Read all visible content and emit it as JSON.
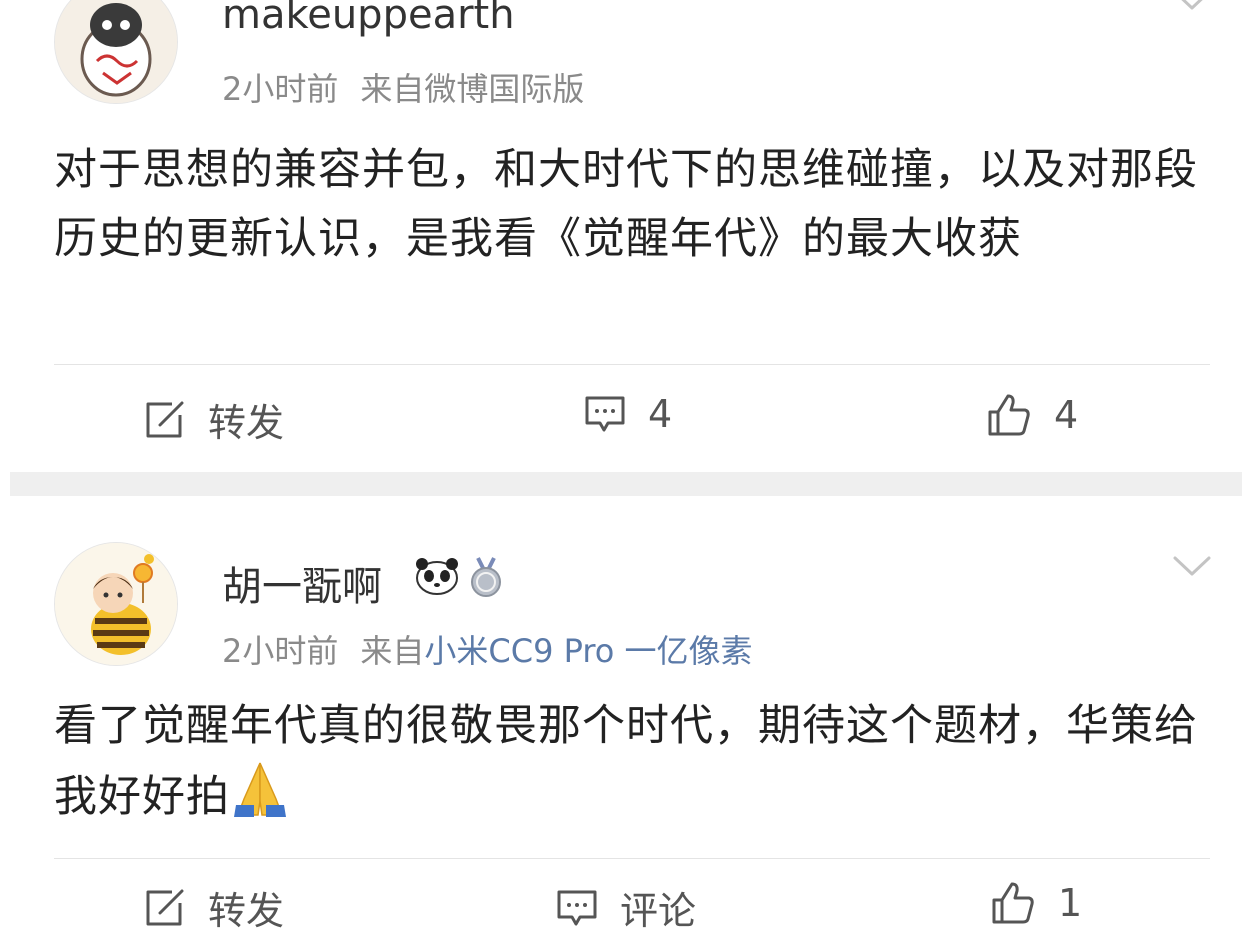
{
  "posts": [
    {
      "username": "makeuppearth",
      "time": "2小时前",
      "source_prefix": "来自",
      "source_name": "微博国际版",
      "content": "对于思想的兼容并包，和大时代下的思维碰撞，以及对那段历史的更新认识，是我看《觉醒年代》的最大收获",
      "actions": {
        "repost": "转发",
        "comment": "4",
        "like": "4"
      }
    },
    {
      "username": "胡一翫啊",
      "time": "2小时前",
      "source_prefix": "来自",
      "source_name": "小米CC9 Pro 一亿像素",
      "content": "看了觉醒年代真的很敬畏那个时代，期待这个题材，华策给我好好拍",
      "content_emoji": "pray-emoji",
      "actions": {
        "repost": "转发",
        "comment": "评论",
        "like": "1"
      }
    }
  ],
  "icons": {
    "repost": "repost-icon",
    "comment": "comment-icon",
    "like": "thumbs-up-icon",
    "menu": "chevron-down-icon",
    "badge_panda": "panda-badge-icon",
    "badge_answer": "answer-medal-icon"
  },
  "colors": {
    "link": "#5b7aa8",
    "meta": "#8a8a8a",
    "text": "#222222",
    "separator": "#efefef"
  }
}
